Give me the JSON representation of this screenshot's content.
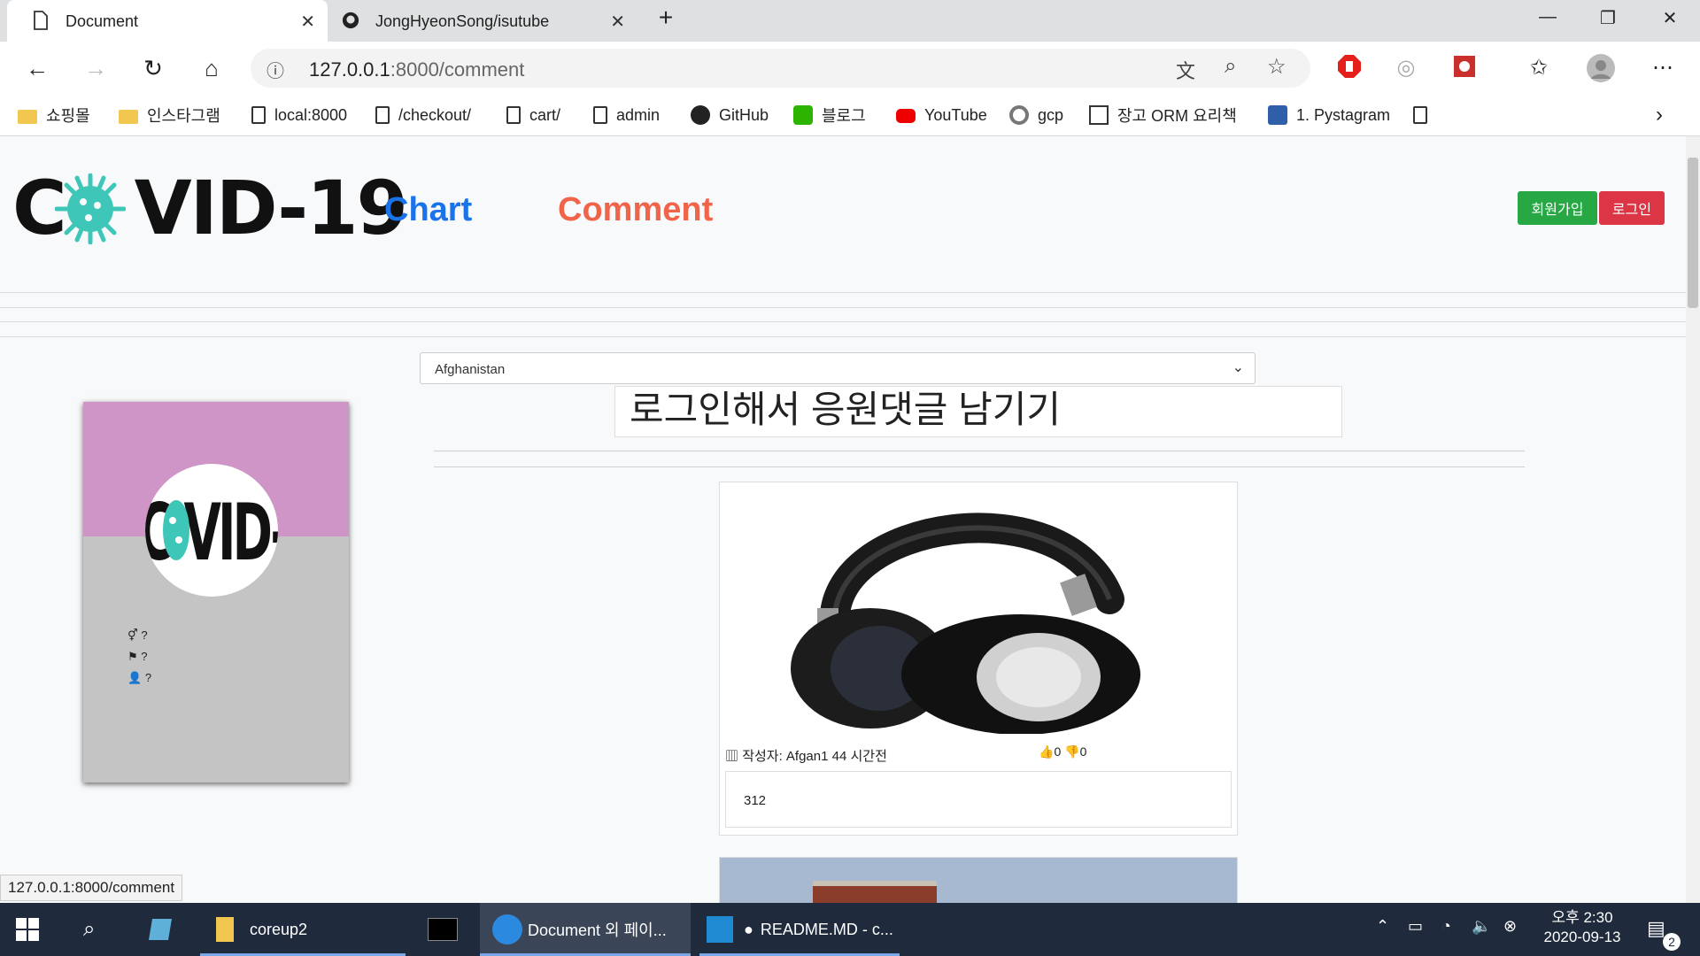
{
  "browser": {
    "tabs": [
      {
        "title": "Document",
        "active": true
      },
      {
        "title": "JongHyeonSong/isutube",
        "active": false
      }
    ],
    "url": {
      "host": "127.0.0.1",
      "path": ":8000/comment"
    },
    "bookmarks": [
      {
        "label": "쇼핑몰",
        "icon": "folder-icon"
      },
      {
        "label": "인스타그램",
        "icon": "folder-icon"
      },
      {
        "label": "local:8000",
        "icon": "page-icon"
      },
      {
        "label": "/checkout/",
        "icon": "page-icon"
      },
      {
        "label": "cart/",
        "icon": "page-icon"
      },
      {
        "label": "admin",
        "icon": "page-icon"
      },
      {
        "label": "GitHub",
        "icon": "github-icon"
      },
      {
        "label": "블로그",
        "icon": "blog-icon"
      },
      {
        "label": "YouTube",
        "icon": "youtube-icon"
      },
      {
        "label": "gcp",
        "icon": "gcp-icon"
      },
      {
        "label": "장고 ORM 요리책",
        "icon": "book-icon"
      },
      {
        "label": "1. Pystagram",
        "icon": "pystagram-icon"
      }
    ],
    "status_url": "127.0.0.1:8000/comment"
  },
  "site": {
    "logo": "C VID-19",
    "nav": {
      "chart": "Chart",
      "comment": "Comment"
    },
    "signup": "회원가입",
    "login": "로그인",
    "colors": {
      "chart": "#1a73e8",
      "comment": "#f06449",
      "signup": "#28a745",
      "login": "#dc3545",
      "profile_top": "#cf95c6"
    }
  },
  "main": {
    "country_selected": "Afghanistan",
    "login_prompt": "로그인해서 응원댓글 남기기",
    "profile": {
      "avatar_text": "C VID-19",
      "fields": [
        {
          "icon": "gender-icon",
          "value": "?"
        },
        {
          "icon": "flag-icon",
          "value": "?"
        },
        {
          "icon": "user-icon",
          "value": "?"
        }
      ]
    },
    "comments": [
      {
        "author": "작성자: Afgan1",
        "time": "44 시간전",
        "likes": "0",
        "dislikes": "0",
        "body": "312",
        "image": "headphones"
      }
    ]
  },
  "taskbar": {
    "items": [
      {
        "label": "coreup2"
      },
      {
        "label": "Document 외 페이..."
      },
      {
        "label": "README.MD - c..."
      }
    ],
    "clock": {
      "ampm_time": "오후 2:30",
      "date": "2020-09-13"
    },
    "notifications": "2"
  }
}
